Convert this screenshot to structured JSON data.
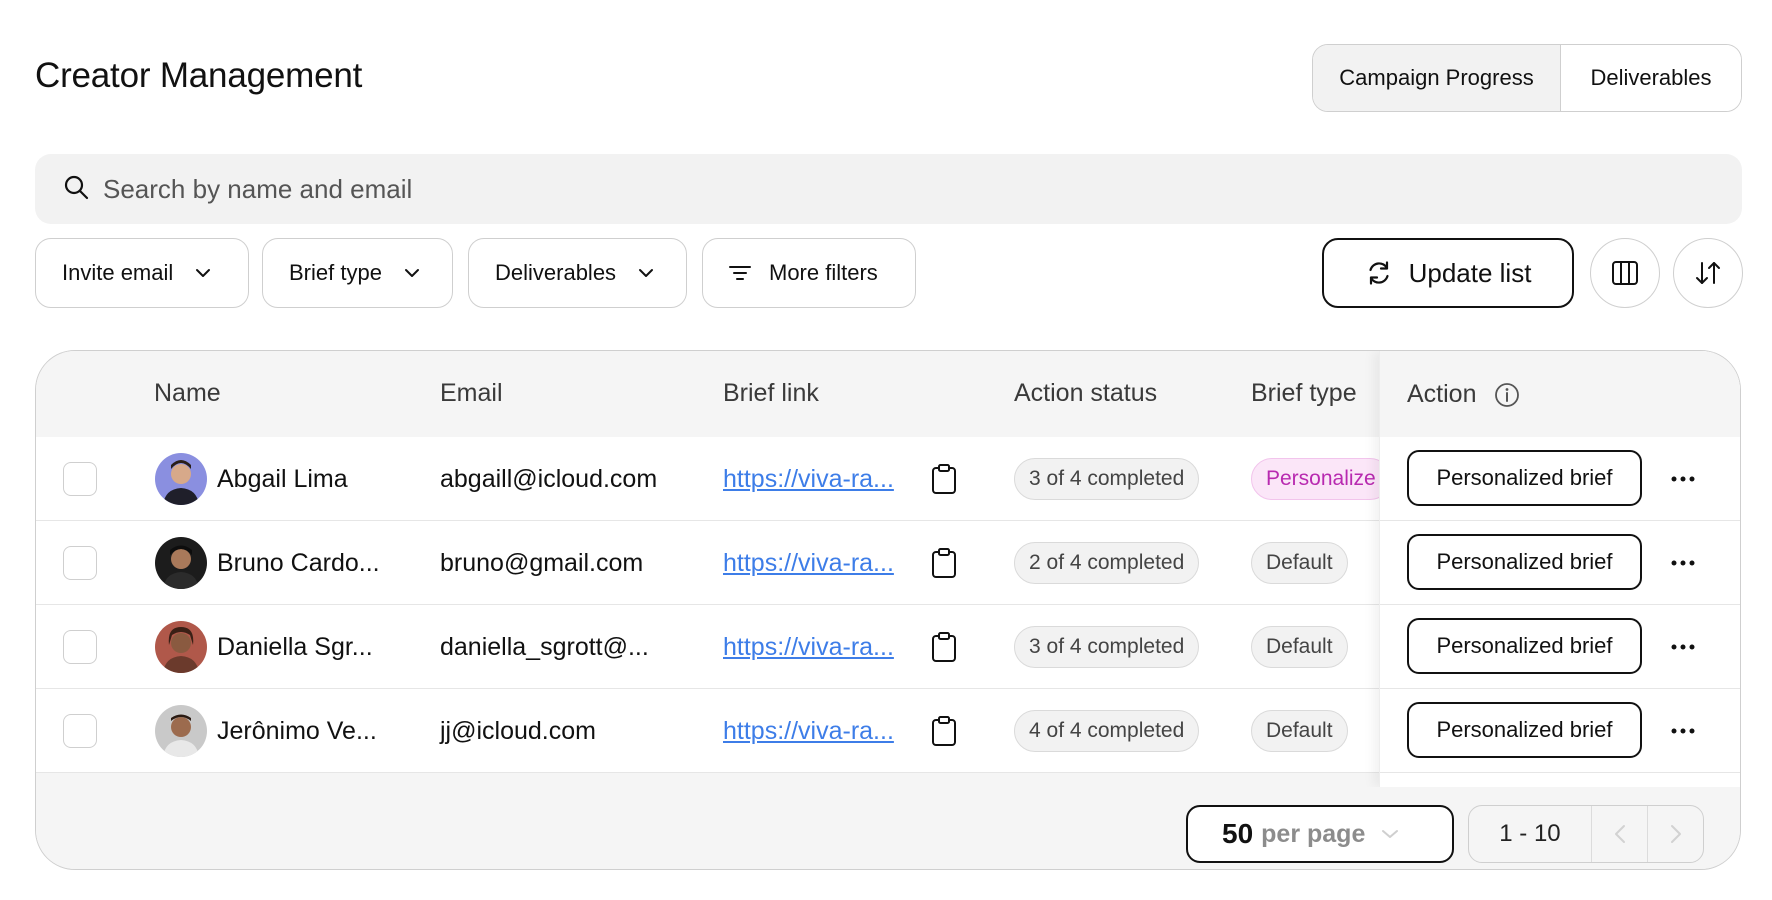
{
  "header": {
    "title": "Creator Management"
  },
  "view_toggle": {
    "campaign_progress": "Campaign Progress",
    "deliverables": "Deliverables"
  },
  "search": {
    "placeholder": "Search by name and email"
  },
  "filters": {
    "invite_email": "Invite email",
    "brief_type": "Brief type",
    "deliverables": "Deliverables",
    "more_filters": "More filters"
  },
  "toolbar": {
    "update_list": "Update list"
  },
  "table": {
    "columns": {
      "name": "Name",
      "email": "Email",
      "brief_link": "Brief link",
      "action_status": "Action status",
      "brief_type": "Brief type",
      "action": "Action"
    },
    "rows": [
      {
        "name": "Abgail Lima",
        "email": "abgaill@icloud.com",
        "brief_link": "https://viva-ra...",
        "action_status": "3 of 4 completed",
        "brief_type": "Personalize",
        "action": "Personalized brief"
      },
      {
        "name": "Bruno Cardo...",
        "email": "bruno@gmail.com",
        "brief_link": "https://viva-ra...",
        "action_status": "2 of 4 completed",
        "brief_type": "Default",
        "action": "Personalized brief"
      },
      {
        "name": "Daniella Sgr...",
        "email": "daniella_sgrott@...",
        "brief_link": "https://viva-ra...",
        "action_status": "3 of 4 completed",
        "brief_type": "Default",
        "action": "Personalized brief"
      },
      {
        "name": "Jerônimo Ve...",
        "email": "jj@icloud.com",
        "brief_link": "https://viva-ra...",
        "action_status": "4 of 4 completed",
        "brief_type": "Default",
        "action": "Personalized brief"
      }
    ]
  },
  "pagination": {
    "per_page_value": "50",
    "per_page_label": "per page",
    "range": "1 - 10"
  },
  "colors": {
    "link": "#3d7de8",
    "personalized_badge_text": "#b82ab0",
    "personalized_badge_bg": "#fbe6f8",
    "panel_bg": "#f5f5f5"
  },
  "icons": [
    "search-icon",
    "chevron-down-icon",
    "filter-lines-icon",
    "refresh-icon",
    "columns-icon",
    "sort-arrows-icon",
    "info-icon",
    "clipboard-icon",
    "more-dots-icon",
    "chevron-left-icon",
    "chevron-right-icon"
  ]
}
